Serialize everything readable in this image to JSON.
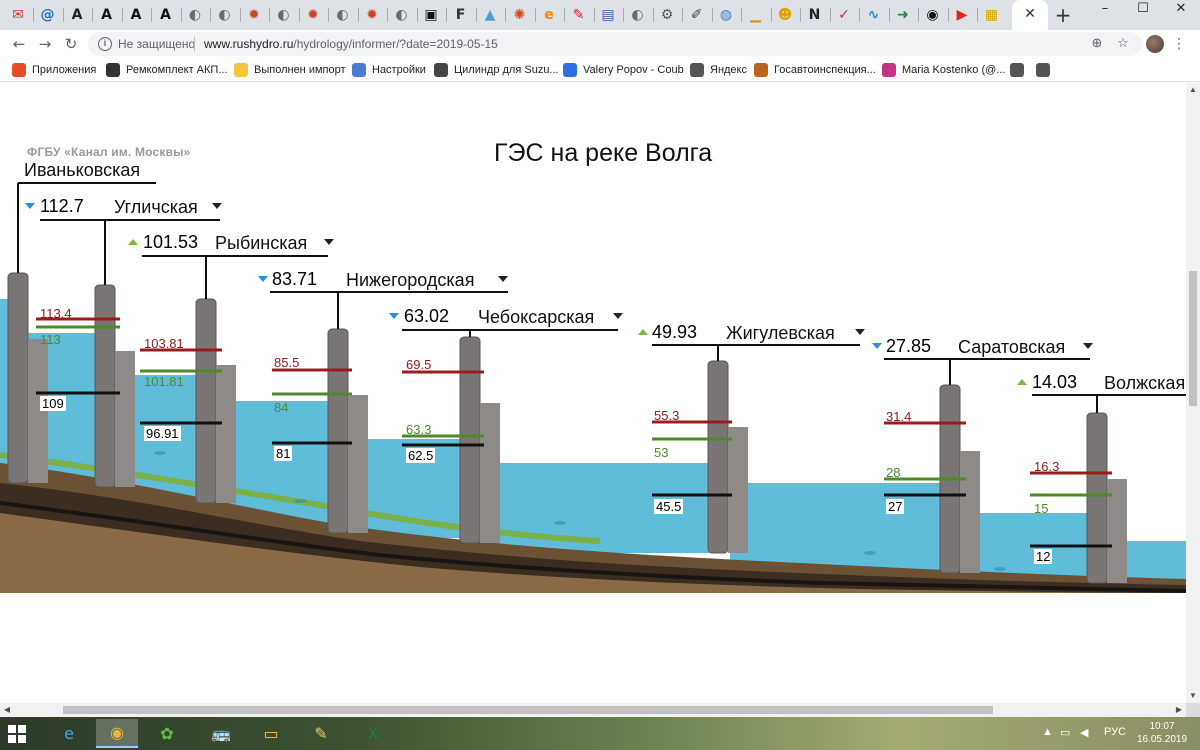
{
  "browser": {
    "tab_icons": [
      {
        "name": "tab-favicon-mail-ru",
        "glyph": "✉",
        "color": "#d6312b"
      },
      {
        "name": "tab-favicon-at",
        "glyph": "@",
        "color": "#1d6fc4"
      },
      {
        "name": "tab-favicon-a-yellow",
        "glyph": "A",
        "color": "#222222"
      },
      {
        "name": "tab-favicon-a-bold",
        "glyph": "A",
        "color": "#111111"
      },
      {
        "name": "tab-favicon-a-bold-2",
        "glyph": "A",
        "color": "#111111"
      },
      {
        "name": "tab-favicon-a-bold-3",
        "glyph": "A",
        "color": "#111111"
      },
      {
        "name": "tab-favicon-globe",
        "glyph": "◐",
        "color": "#6b6b6b"
      },
      {
        "name": "tab-favicon-globe-2",
        "glyph": "◐",
        "color": "#6b6b6b"
      },
      {
        "name": "tab-favicon-gear-red",
        "glyph": "✹",
        "color": "#c8442b"
      },
      {
        "name": "tab-favicon-globe-3",
        "glyph": "◐",
        "color": "#6b6b6b"
      },
      {
        "name": "tab-favicon-gear-red-2",
        "glyph": "✹",
        "color": "#c8442b"
      },
      {
        "name": "tab-favicon-globe-4",
        "glyph": "◐",
        "color": "#6b6b6b"
      },
      {
        "name": "tab-favicon-gear-red-3",
        "glyph": "✹",
        "color": "#c8442b"
      },
      {
        "name": "tab-favicon-globe-5",
        "glyph": "◐",
        "color": "#6b6b6b"
      },
      {
        "name": "tab-favicon-terminal",
        "glyph": "▣",
        "color": "#111111"
      },
      {
        "name": "tab-favicon-f",
        "glyph": "F",
        "color": "#333333"
      },
      {
        "name": "tab-favicon-mountain",
        "glyph": "▲",
        "color": "#4a9fd6"
      },
      {
        "name": "tab-favicon-sun",
        "glyph": "✺",
        "color": "#d24a1e"
      },
      {
        "name": "tab-favicon-e-orange",
        "glyph": "e",
        "color": "#f08a00"
      },
      {
        "name": "tab-favicon-pencil",
        "glyph": "✎",
        "color": "#cc2a2a"
      },
      {
        "name": "tab-favicon-news",
        "glyph": "▤",
        "color": "#3c5aa8"
      },
      {
        "name": "tab-favicon-globe-6",
        "glyph": "◐",
        "color": "#6b6b6b"
      },
      {
        "name": "tab-favicon-cog",
        "glyph": "⚙",
        "color": "#555555"
      },
      {
        "name": "tab-favicon-edit",
        "glyph": "✐",
        "color": "#444444"
      },
      {
        "name": "tab-favicon-blue-globe",
        "glyph": "◍",
        "color": "#3d7ac8"
      },
      {
        "name": "tab-favicon-chart",
        "glyph": "▁",
        "color": "#c79b1e"
      },
      {
        "name": "tab-favicon-cat",
        "glyph": "☻",
        "color": "#e0a000"
      },
      {
        "name": "tab-favicon-n",
        "glyph": "N",
        "color": "#222222"
      },
      {
        "name": "tab-favicon-check",
        "glyph": "✓",
        "color": "#d12828"
      },
      {
        "name": "tab-favicon-wave",
        "glyph": "∿",
        "color": "#2d8bc0"
      },
      {
        "name": "tab-favicon-arrow",
        "glyph": "➜",
        "color": "#1f8a3a"
      },
      {
        "name": "tab-favicon-record",
        "glyph": "◉",
        "color": "#111111"
      },
      {
        "name": "tab-favicon-youtube",
        "glyph": "▶",
        "color": "#e62117"
      },
      {
        "name": "tab-favicon-yellow-box",
        "glyph": "▦",
        "color": "#d3a514"
      }
    ],
    "close_tab_glyph": "✕",
    "new_tab_glyph": "+",
    "window_buttons": {
      "minimize": "–",
      "maximize": "☐",
      "close": "✕"
    },
    "security_label": "Не защищено",
    "url_host": "www.rushydro.ru",
    "url_path": "/hydrology/informer/?date=2019-05-15",
    "bookmarks": [
      {
        "label": "Приложения",
        "icon": "apps-grid-icon",
        "color": "#e44d26"
      },
      {
        "label": "Ремкомплект АКП...",
        "icon": "gear-icon",
        "color": "#333333"
      },
      {
        "label": "Выполнен импорт",
        "icon": "folder-icon",
        "color": "#f4c542"
      },
      {
        "label": "Настройки",
        "icon": "settings-icon",
        "color": "#4a7bd0"
      },
      {
        "label": "Цилиндр для Suzu...",
        "icon": "tools-icon",
        "color": "#444444"
      },
      {
        "label": "Valery Popov - Coub",
        "icon": "coub-icon",
        "color": "#2f6fe0"
      },
      {
        "label": "Яндекс",
        "icon": "globe-icon",
        "color": "#555555"
      },
      {
        "label": "Госавтоинспекция...",
        "icon": "emblem-icon",
        "color": "#b5651d"
      },
      {
        "label": "Maria Kostenko (@...",
        "icon": "instagram-icon",
        "color": "#c13584"
      },
      {
        "label": "",
        "icon": "globe-icon",
        "color": "#555555"
      },
      {
        "label": "",
        "icon": "globe-icon",
        "color": "#555555"
      }
    ]
  },
  "page": {
    "org": "ФГБУ «Канал им. Москвы»",
    "title": "ГЭС на реке Волга",
    "colors": {
      "water": "#5fbdd9",
      "water_deep": "#3fa8cc",
      "sky": "#ffffff",
      "dam": "#7a7676",
      "red_line": "#9b1c1c",
      "green_line": "#4f8a2a",
      "black_line": "#111111",
      "trend_up": "#7ab648",
      "trend_down": "#2a8ed0"
    },
    "stations": [
      {
        "name": "Иваньковская",
        "level": "",
        "trend": "none",
        "levels": {
          "red": "113.4",
          "green": "113",
          "black": "109"
        }
      },
      {
        "name": "Угличская",
        "level": "112.7",
        "trend": "down",
        "levels": {
          "red": "103.81",
          "green": "101.81",
          "black": "96.91"
        }
      },
      {
        "name": "Рыбинская",
        "level": "101.53",
        "trend": "up",
        "levels": {
          "red": "85.5",
          "green": "84",
          "black": "81"
        }
      },
      {
        "name": "Нижегородская",
        "level": "83.71",
        "trend": "down",
        "levels": {
          "red": "69.5",
          "green": "63.3",
          "black": "62.5"
        }
      },
      {
        "name": "Чебоксарская",
        "level": "63.02",
        "trend": "down",
        "levels": {
          "red": "55.3",
          "green": "53",
          "black": "45.5"
        }
      },
      {
        "name": "Жигулевская",
        "level": "49.93",
        "trend": "up",
        "levels": {
          "red": "31.4",
          "green": "28",
          "black": "27"
        }
      },
      {
        "name": "Саратовская",
        "level": "27.85",
        "trend": "down",
        "levels": {
          "red": "16.3",
          "green": "15",
          "black": "12"
        }
      },
      {
        "name": "Волжская",
        "level": "14.03",
        "trend": "up",
        "levels": {
          "red": "",
          "green": "",
          "black": ""
        }
      }
    ]
  },
  "taskbar": {
    "apps": [
      {
        "name": "taskbar-ie",
        "glyph": "e",
        "color": "#4aa3e8"
      },
      {
        "name": "taskbar-chrome",
        "glyph": "◉",
        "color": "#e8b83c"
      },
      {
        "name": "taskbar-app-green",
        "glyph": "✿",
        "color": "#61c13f"
      },
      {
        "name": "taskbar-bus",
        "glyph": "🚌",
        "color": "#2f7fd0"
      },
      {
        "name": "taskbar-explorer",
        "glyph": "▭",
        "color": "#f2c84b"
      },
      {
        "name": "taskbar-notes",
        "glyph": "✎",
        "color": "#e7d55a"
      },
      {
        "name": "taskbar-excel",
        "glyph": "X",
        "color": "#1f7a44"
      }
    ],
    "lang": "РУС",
    "time": "10:07",
    "date": "16.05.2019"
  }
}
